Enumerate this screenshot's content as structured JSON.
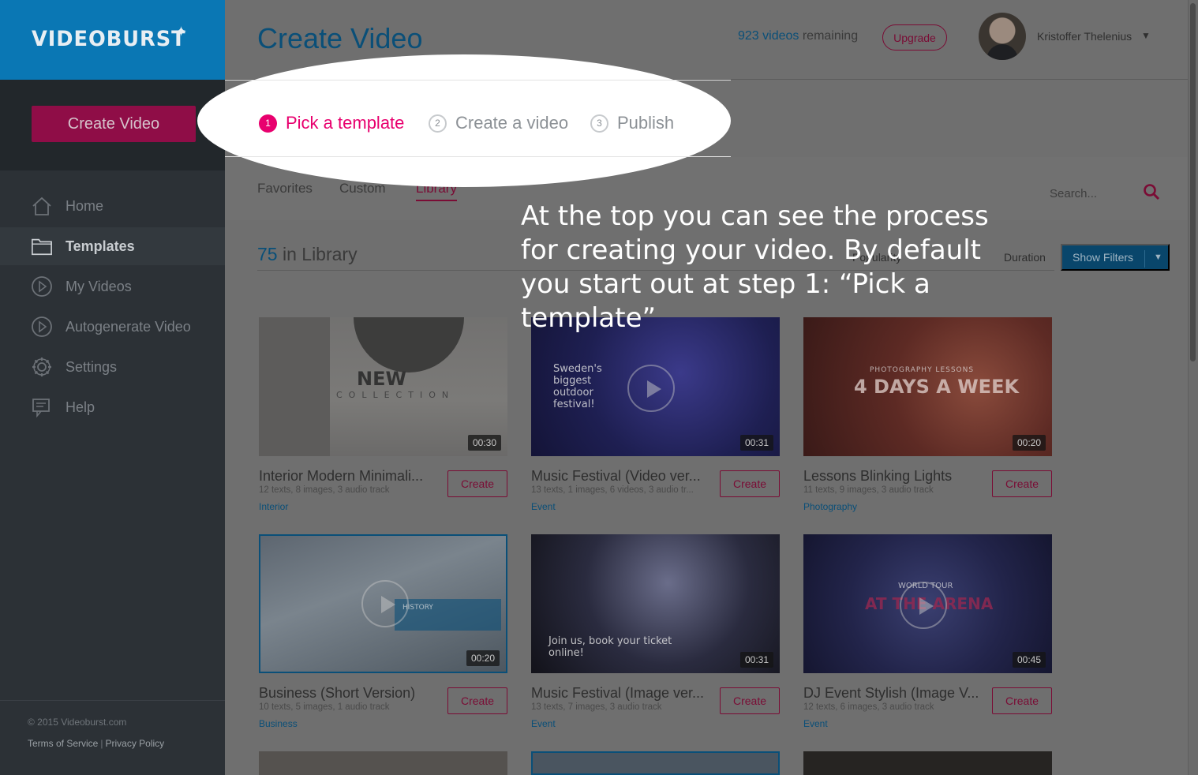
{
  "sidebar": {
    "logo": "VIDEOBURST",
    "create_label": "Create Video",
    "items": [
      {
        "label": "Home",
        "icon": "home-icon"
      },
      {
        "label": "Templates",
        "icon": "folder-icon"
      },
      {
        "label": "My Videos",
        "icon": "play-circle-icon"
      },
      {
        "label": "Autogenerate Video",
        "icon": "play-circle-icon"
      },
      {
        "label": "Settings",
        "icon": "gear-icon"
      },
      {
        "label": "Help",
        "icon": "help-icon"
      }
    ],
    "copyright": "© 2015 Videoburst.com",
    "terms": "Terms of Service",
    "privacy": "Privacy Policy"
  },
  "header": {
    "title": "Create Video",
    "remaining_count": "923 videos",
    "remaining_suffix": " remaining",
    "upgrade_label": "Upgrade",
    "user_name": "Kristoffer Thelenius"
  },
  "steps": [
    {
      "num": "1",
      "label": "Pick a template"
    },
    {
      "num": "2",
      "label": "Create a video"
    },
    {
      "num": "3",
      "label": "Publish"
    }
  ],
  "tabs": [
    "Favorites",
    "Custom",
    "Library"
  ],
  "search": {
    "placeholder": "Search..."
  },
  "library": {
    "count": "75",
    "suffix": " in Library",
    "sort_popularity": "Popularity",
    "sort_duration": "Duration",
    "show_filters": "Show Filters"
  },
  "callout": "At the top you can see the process for creating your video. By default you start out at step 1: “Pick a template”",
  "cards": [
    {
      "title": "Interior Modern Minimali...",
      "meta": "12 texts, 8 images, 3 audio track",
      "category": "Interior",
      "duration": "00:30",
      "create": "Create",
      "thumb_text": "NEW",
      "thumb_sub": "COLLECTION"
    },
    {
      "title": "Music Festival (Video ver...",
      "meta": "13 texts, 1 images, 6 videos, 3 audio tr...",
      "category": "Event",
      "duration": "00:31",
      "create": "Create",
      "thumb_text": "Sweden's biggest outdoor festival!",
      "thumb_sub": ""
    },
    {
      "title": "Lessons Blinking Lights",
      "meta": "11 texts, 9 images, 3 audio track",
      "category": "Photography",
      "duration": "00:20",
      "create": "Create",
      "thumb_text": "4 DAYS A WEEK",
      "thumb_sub": "PHOTOGRAPHY LESSONS"
    },
    {
      "title": "Business (Short Version)",
      "meta": "10 texts, 5 images, 1 audio track",
      "category": "Business",
      "duration": "00:20",
      "create": "Create",
      "thumb_text": "HISTORY",
      "thumb_sub": ""
    },
    {
      "title": "Music Festival (Image ver...",
      "meta": "13 texts, 7 images, 3 audio track",
      "category": "Event",
      "duration": "00:31",
      "create": "Create",
      "thumb_text": "Join us, book your ticket online!",
      "thumb_sub": ""
    },
    {
      "title": "DJ Event Stylish (Image V...",
      "meta": "12 texts, 6 images, 3 audio track",
      "category": "Event",
      "duration": "00:45",
      "create": "Create",
      "thumb_text": "AT THE ARENA",
      "thumb_sub": "WORLD TOUR"
    }
  ],
  "colors": {
    "accent": "#e8006e",
    "brand_blue": "#0a77b4",
    "dark_blue": "#0a4f78",
    "sidebar": "#2c3136"
  }
}
